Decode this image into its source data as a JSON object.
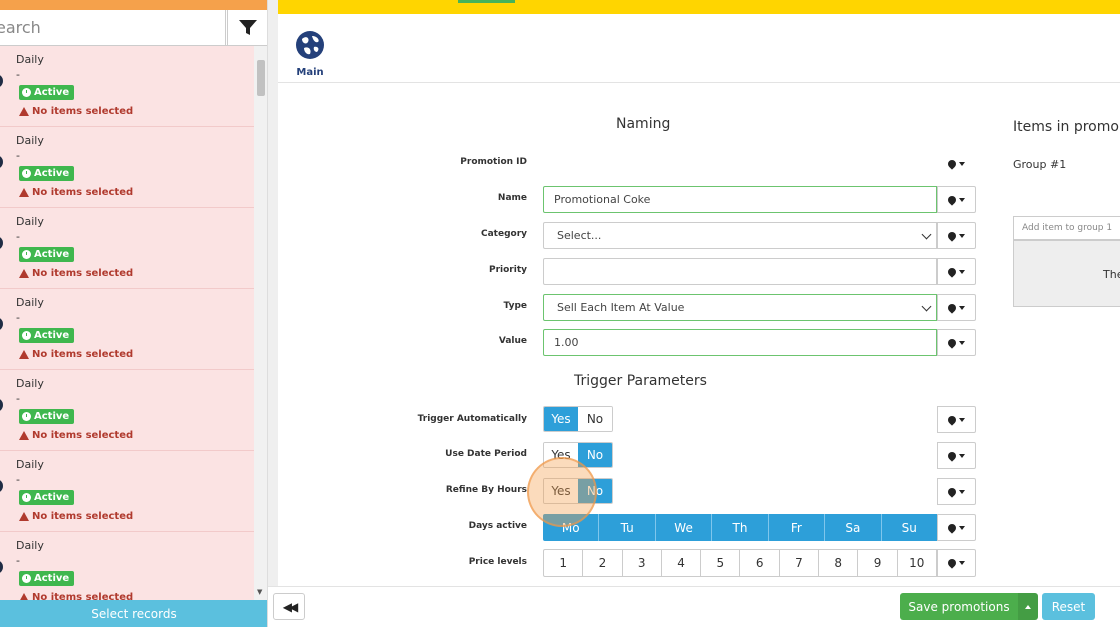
{
  "sidebar": {
    "search_placeholder": "earch",
    "filter_icon": "filter-icon",
    "records": [
      {
        "title": "Daily",
        "dash": "-",
        "status": "Active",
        "warning": "No items selected"
      },
      {
        "title": "Daily",
        "dash": "-",
        "status": "Active",
        "warning": "No items selected"
      },
      {
        "title": "Daily",
        "dash": "-",
        "status": "Active",
        "warning": "No items selected"
      },
      {
        "title": "Daily",
        "dash": "-",
        "status": "Active",
        "warning": "No items selected"
      },
      {
        "title": "Daily",
        "dash": "-",
        "status": "Active",
        "warning": "No items selected"
      },
      {
        "title": "Daily",
        "dash": "-",
        "status": "Active",
        "warning": "No items selected"
      },
      {
        "title": "Daily",
        "dash": "-",
        "status": "Active",
        "warning": "No items selected"
      }
    ],
    "select_records": "Select records"
  },
  "tabs": {
    "main_label": "Main"
  },
  "naming": {
    "title": "Naming",
    "promotion_id_label": "Promotion ID",
    "name_label": "Name",
    "name_value": "Promotional Coke",
    "category_label": "Category",
    "category_value": "Select...",
    "priority_label": "Priority",
    "priority_value": "",
    "type_label": "Type",
    "type_value": "Sell Each Item At Value",
    "value_label": "Value",
    "value_value": "1.00"
  },
  "trigger": {
    "title": "Trigger Parameters",
    "trigger_auto_label": "Trigger Automatically",
    "use_date_label": "Use Date Period",
    "refine_hours_label": "Refine By Hours",
    "yes": "Yes",
    "no": "No",
    "days_label": "Days active",
    "days": [
      "Mo",
      "Tu",
      "We",
      "Th",
      "Fr",
      "Sa",
      "Su"
    ],
    "price_levels_label": "Price levels",
    "price_levels": [
      "1",
      "2",
      "3",
      "4",
      "5",
      "6",
      "7",
      "8",
      "9",
      "10"
    ]
  },
  "items": {
    "title": "Items in promo",
    "group_label": "Group #1",
    "add_placeholder": "Add item to group 1",
    "panel_text": "The"
  },
  "footer": {
    "save": "Save promotions",
    "reset": "Reset"
  },
  "colors": {
    "accent_blue": "#2d9fd9",
    "save_green": "#4cae4c",
    "reset_blue": "#5bc0de",
    "header_yellow": "#ffd500",
    "record_bg": "#fbe3e3"
  }
}
